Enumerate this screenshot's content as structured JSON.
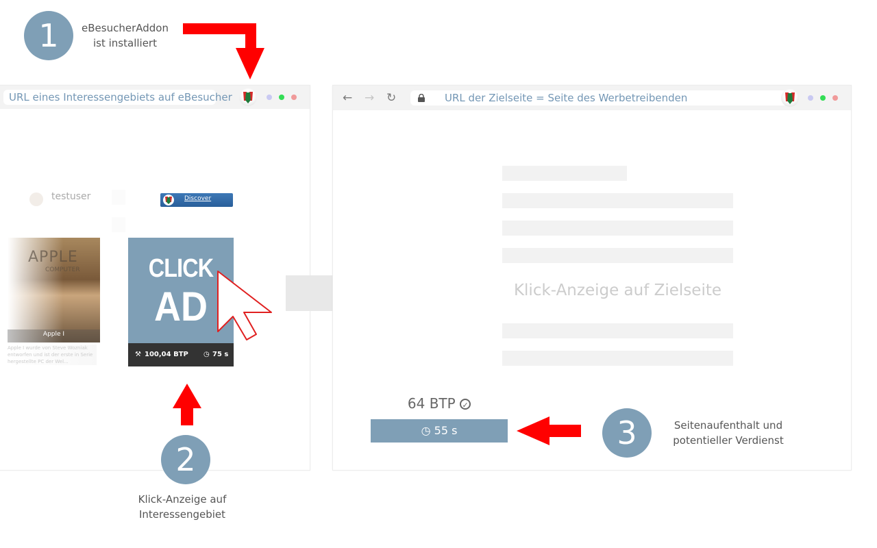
{
  "steps": [
    {
      "number": "1",
      "line1": "eBesucherAddon",
      "line2": "ist installiert"
    },
    {
      "number": "2",
      "line1": "Klick-Anzeige auf",
      "line2": "Interessengebiet"
    },
    {
      "number": "3",
      "line1": "Seitenaufenthalt und",
      "line2": "potentieller Verdienst"
    }
  ],
  "left_window": {
    "url": "URL eines Interessengebiets auf eBesucher",
    "username": "testuser",
    "discover_label": "Discover",
    "apple_card": {
      "title": "Apple I",
      "image_text_1": "APPLE",
      "image_text_2": "COMPUTER",
      "description": "Apple I wurde von Steve Wozniak entworfen und ist der erste in Serie hergestellte PC der Wel..."
    },
    "ad_card": {
      "line1": "CLICK",
      "line2": "AD",
      "price": "100,04 BTP",
      "duration": "75 s"
    }
  },
  "right_window": {
    "url": "URL der Zielseite = Seite des Werbetreibenden",
    "center_label": "Klick-Anzeige auf Zielseite",
    "earnings": "64 BTP",
    "timer": "55 s"
  },
  "colors": {
    "step_circle": "#7f9fb6",
    "arrow_red": "#ff0000",
    "url_text": "#7497b5",
    "dot_purple": "#c9c9f2",
    "dot_green": "#33dd55",
    "dot_red": "#f09a9a",
    "timer_bar": "#7f9fb6"
  }
}
